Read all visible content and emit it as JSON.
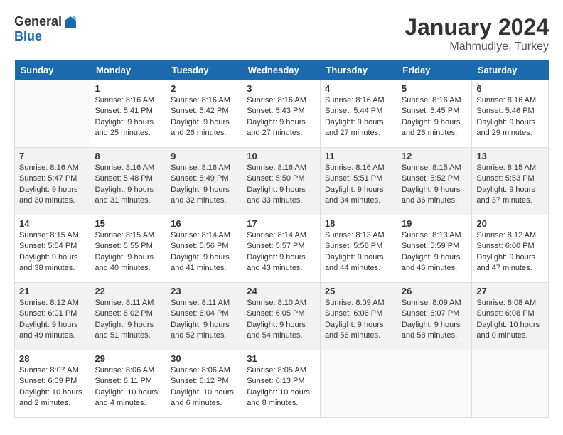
{
  "header": {
    "logo_general": "General",
    "logo_blue": "Blue",
    "month_title": "January 2024",
    "location": "Mahmudiye, Turkey"
  },
  "days": [
    "Sunday",
    "Monday",
    "Tuesday",
    "Wednesday",
    "Thursday",
    "Friday",
    "Saturday"
  ],
  "weeks": [
    [
      {
        "day": "",
        "sunrise": "",
        "sunset": "",
        "daylight": ""
      },
      {
        "day": "1",
        "sunrise": "Sunrise: 8:16 AM",
        "sunset": "Sunset: 5:41 PM",
        "daylight": "Daylight: 9 hours and 25 minutes."
      },
      {
        "day": "2",
        "sunrise": "Sunrise: 8:16 AM",
        "sunset": "Sunset: 5:42 PM",
        "daylight": "Daylight: 9 hours and 26 minutes."
      },
      {
        "day": "3",
        "sunrise": "Sunrise: 8:16 AM",
        "sunset": "Sunset: 5:43 PM",
        "daylight": "Daylight: 9 hours and 27 minutes."
      },
      {
        "day": "4",
        "sunrise": "Sunrise: 8:16 AM",
        "sunset": "Sunset: 5:44 PM",
        "daylight": "Daylight: 9 hours and 27 minutes."
      },
      {
        "day": "5",
        "sunrise": "Sunrise: 8:16 AM",
        "sunset": "Sunset: 5:45 PM",
        "daylight": "Daylight: 9 hours and 28 minutes."
      },
      {
        "day": "6",
        "sunrise": "Sunrise: 8:16 AM",
        "sunset": "Sunset: 5:46 PM",
        "daylight": "Daylight: 9 hours and 29 minutes."
      }
    ],
    [
      {
        "day": "7",
        "sunrise": "Sunrise: 8:16 AM",
        "sunset": "Sunset: 5:47 PM",
        "daylight": "Daylight: 9 hours and 30 minutes."
      },
      {
        "day": "8",
        "sunrise": "Sunrise: 8:16 AM",
        "sunset": "Sunset: 5:48 PM",
        "daylight": "Daylight: 9 hours and 31 minutes."
      },
      {
        "day": "9",
        "sunrise": "Sunrise: 8:16 AM",
        "sunset": "Sunset: 5:49 PM",
        "daylight": "Daylight: 9 hours and 32 minutes."
      },
      {
        "day": "10",
        "sunrise": "Sunrise: 8:16 AM",
        "sunset": "Sunset: 5:50 PM",
        "daylight": "Daylight: 9 hours and 33 minutes."
      },
      {
        "day": "11",
        "sunrise": "Sunrise: 8:16 AM",
        "sunset": "Sunset: 5:51 PM",
        "daylight": "Daylight: 9 hours and 34 minutes."
      },
      {
        "day": "12",
        "sunrise": "Sunrise: 8:15 AM",
        "sunset": "Sunset: 5:52 PM",
        "daylight": "Daylight: 9 hours and 36 minutes."
      },
      {
        "day": "13",
        "sunrise": "Sunrise: 8:15 AM",
        "sunset": "Sunset: 5:53 PM",
        "daylight": "Daylight: 9 hours and 37 minutes."
      }
    ],
    [
      {
        "day": "14",
        "sunrise": "Sunrise: 8:15 AM",
        "sunset": "Sunset: 5:54 PM",
        "daylight": "Daylight: 9 hours and 38 minutes."
      },
      {
        "day": "15",
        "sunrise": "Sunrise: 8:15 AM",
        "sunset": "Sunset: 5:55 PM",
        "daylight": "Daylight: 9 hours and 40 minutes."
      },
      {
        "day": "16",
        "sunrise": "Sunrise: 8:14 AM",
        "sunset": "Sunset: 5:56 PM",
        "daylight": "Daylight: 9 hours and 41 minutes."
      },
      {
        "day": "17",
        "sunrise": "Sunrise: 8:14 AM",
        "sunset": "Sunset: 5:57 PM",
        "daylight": "Daylight: 9 hours and 43 minutes."
      },
      {
        "day": "18",
        "sunrise": "Sunrise: 8:13 AM",
        "sunset": "Sunset: 5:58 PM",
        "daylight": "Daylight: 9 hours and 44 minutes."
      },
      {
        "day": "19",
        "sunrise": "Sunrise: 8:13 AM",
        "sunset": "Sunset: 5:59 PM",
        "daylight": "Daylight: 9 hours and 46 minutes."
      },
      {
        "day": "20",
        "sunrise": "Sunrise: 8:12 AM",
        "sunset": "Sunset: 6:00 PM",
        "daylight": "Daylight: 9 hours and 47 minutes."
      }
    ],
    [
      {
        "day": "21",
        "sunrise": "Sunrise: 8:12 AM",
        "sunset": "Sunset: 6:01 PM",
        "daylight": "Daylight: 9 hours and 49 minutes."
      },
      {
        "day": "22",
        "sunrise": "Sunrise: 8:11 AM",
        "sunset": "Sunset: 6:02 PM",
        "daylight": "Daylight: 9 hours and 51 minutes."
      },
      {
        "day": "23",
        "sunrise": "Sunrise: 8:11 AM",
        "sunset": "Sunset: 6:04 PM",
        "daylight": "Daylight: 9 hours and 52 minutes."
      },
      {
        "day": "24",
        "sunrise": "Sunrise: 8:10 AM",
        "sunset": "Sunset: 6:05 PM",
        "daylight": "Daylight: 9 hours and 54 minutes."
      },
      {
        "day": "25",
        "sunrise": "Sunrise: 8:09 AM",
        "sunset": "Sunset: 6:06 PM",
        "daylight": "Daylight: 9 hours and 56 minutes."
      },
      {
        "day": "26",
        "sunrise": "Sunrise: 8:09 AM",
        "sunset": "Sunset: 6:07 PM",
        "daylight": "Daylight: 9 hours and 58 minutes."
      },
      {
        "day": "27",
        "sunrise": "Sunrise: 8:08 AM",
        "sunset": "Sunset: 6:08 PM",
        "daylight": "Daylight: 10 hours and 0 minutes."
      }
    ],
    [
      {
        "day": "28",
        "sunrise": "Sunrise: 8:07 AM",
        "sunset": "Sunset: 6:09 PM",
        "daylight": "Daylight: 10 hours and 2 minutes."
      },
      {
        "day": "29",
        "sunrise": "Sunrise: 8:06 AM",
        "sunset": "Sunset: 6:11 PM",
        "daylight": "Daylight: 10 hours and 4 minutes."
      },
      {
        "day": "30",
        "sunrise": "Sunrise: 8:06 AM",
        "sunset": "Sunset: 6:12 PM",
        "daylight": "Daylight: 10 hours and 6 minutes."
      },
      {
        "day": "31",
        "sunrise": "Sunrise: 8:05 AM",
        "sunset": "Sunset: 6:13 PM",
        "daylight": "Daylight: 10 hours and 8 minutes."
      },
      {
        "day": "",
        "sunrise": "",
        "sunset": "",
        "daylight": ""
      },
      {
        "day": "",
        "sunrise": "",
        "sunset": "",
        "daylight": ""
      },
      {
        "day": "",
        "sunrise": "",
        "sunset": "",
        "daylight": ""
      }
    ]
  ]
}
